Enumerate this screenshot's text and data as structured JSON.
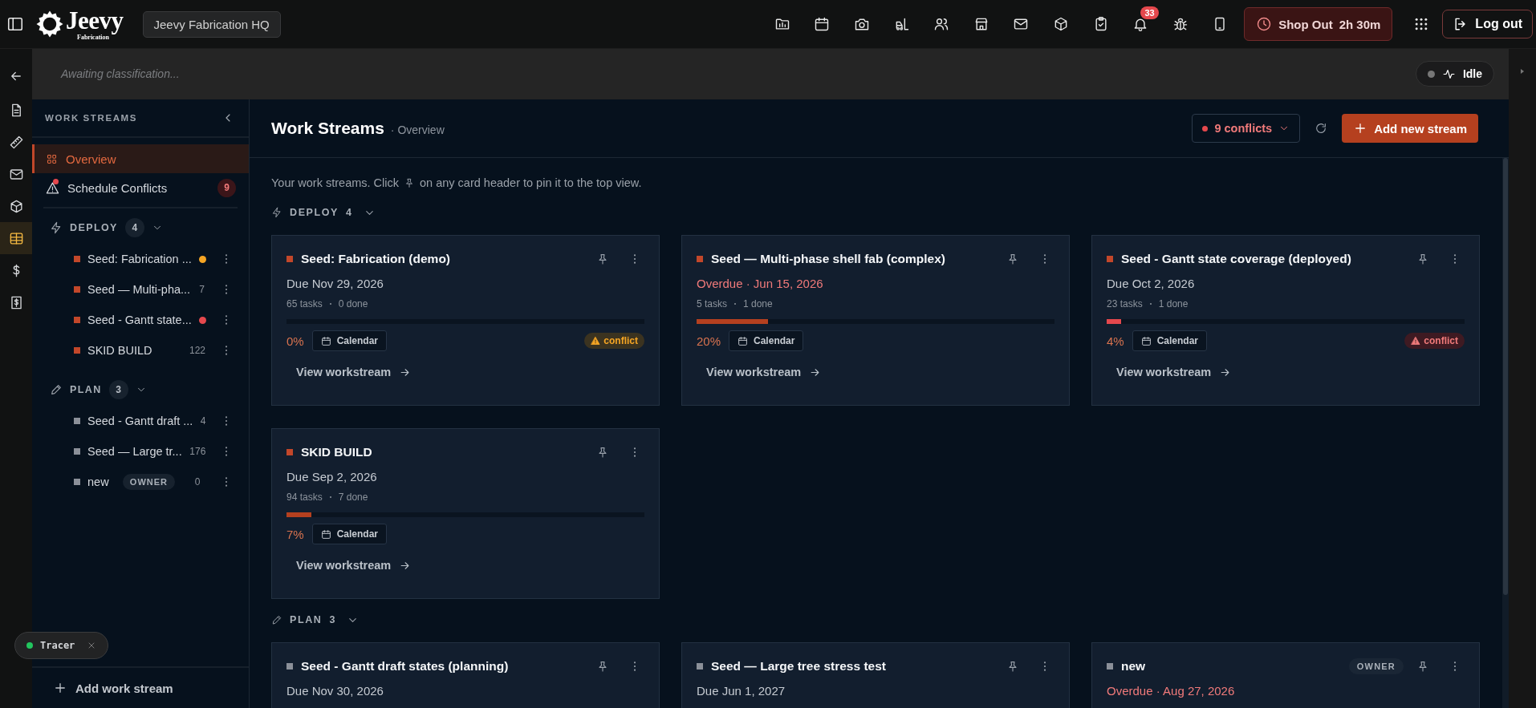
{
  "topbar": {
    "logo": {
      "name": "Jeevy",
      "sub": "Fabrication"
    },
    "workspace": "Jeevy Fabrication HQ",
    "notifications_count": "33",
    "shop_out": {
      "label": "Shop Out",
      "time": "2h 30m"
    },
    "logout": "Log out"
  },
  "rail_items": [
    {
      "selected": false
    },
    {
      "selected": false
    },
    {
      "selected": false
    },
    {
      "selected": false
    },
    {
      "selected": true
    },
    {
      "selected": false
    },
    {
      "selected": false
    }
  ],
  "classification": {
    "text": "Awaiting classification...",
    "status": "Idle"
  },
  "sidebar": {
    "title": "WORK STREAMS",
    "nav": [
      {
        "kind": "overview",
        "label": "Overview",
        "selected": true
      },
      {
        "kind": "conflicts",
        "label": "Schedule Conflicts",
        "selected": false,
        "count": "9",
        "alert": true
      }
    ],
    "groups": [
      {
        "kind": "deploy",
        "label": "DEPLOY",
        "count": "4",
        "expanded": true,
        "color": "#c2472a",
        "items": [
          {
            "label": "Seed: Fabrication ...",
            "color": "#f5a524"
          },
          {
            "label": "Seed — Multi-pha...",
            "count": "7"
          },
          {
            "label": "Seed - Gantt state...",
            "color": "#e5484d"
          },
          {
            "label": "SKID BUILD",
            "count": "122"
          }
        ]
      },
      {
        "kind": "plan",
        "label": "PLAN",
        "count": "3",
        "expanded": true,
        "color": "#8b9099",
        "items": [
          {
            "label": "Seed - Gantt draft ...",
            "count": "4"
          },
          {
            "label": "Seed — Large tr...",
            "count": "176"
          },
          {
            "label": "new",
            "badge": "OWNER",
            "count": "0"
          }
        ]
      }
    ],
    "add": "Add work stream"
  },
  "tracer": {
    "label": "Tracer",
    "color": "#22c55e"
  },
  "main": {
    "title": "Work Streams",
    "subtitle": "· Overview",
    "conflicts": "9 conflicts",
    "add": "Add new stream",
    "intro_before": "Your work streams. Click",
    "intro_after": "on any card header to pin it to the top view.",
    "groups": [
      {
        "kind": "deploy",
        "label": "DEPLOY",
        "count": "4",
        "expanded": true,
        "color": "#c2472a",
        "cards": [
          {
            "title": "Seed: Fabrication (demo)",
            "due": "Due Nov 29, 2026",
            "overdue": false,
            "tasks": "65 tasks",
            "done": "0 done",
            "level": 0,
            "pct": "0%",
            "calendar": "Calendar",
            "conflict": {
              "kind": "warning",
              "label": "conflict"
            },
            "link": "View workstream"
          },
          {
            "title": "Seed — Multi-phase shell fab (complex)",
            "due": "Overdue · Jun 15, 2026",
            "overdue": true,
            "tasks": "5 tasks",
            "done": "1 done",
            "level": 0.2,
            "color": "#b5401f",
            "pct": "20%",
            "calendar": "Calendar",
            "link": "View workstream"
          },
          {
            "title": "Seed - Gantt state coverage (deployed)",
            "due": "Due Oct 2, 2026",
            "overdue": false,
            "tasks": "23 tasks",
            "done": "1 done",
            "level": 0.04,
            "color": "#e5484d",
            "pct": "4%",
            "calendar": "Calendar",
            "conflict": {
              "kind": "error",
              "label": "conflict"
            },
            "link": "View workstream"
          },
          {
            "title": "SKID BUILD",
            "due": "Due Sep 2, 2026",
            "overdue": false,
            "tasks": "94 tasks",
            "done": "7 done",
            "level": 0.07,
            "color": "#b5401f",
            "pct": "7%",
            "calendar": "Calendar",
            "link": "View workstream"
          }
        ]
      },
      {
        "kind": "plan",
        "label": "PLAN",
        "count": "3",
        "expanded": true,
        "color": "#8b9099",
        "cards": [
          {
            "title": "Seed - Gantt draft states (planning)",
            "due": "Due Nov 30, 2026",
            "overdue": false
          },
          {
            "title": "Seed — Large tree stress test",
            "due": "Due Jun 1, 2027",
            "overdue": false
          },
          {
            "title": "new",
            "badge": "OWNER",
            "due": "Overdue · Aug 27, 2026",
            "overdue": true
          }
        ]
      }
    ]
  }
}
